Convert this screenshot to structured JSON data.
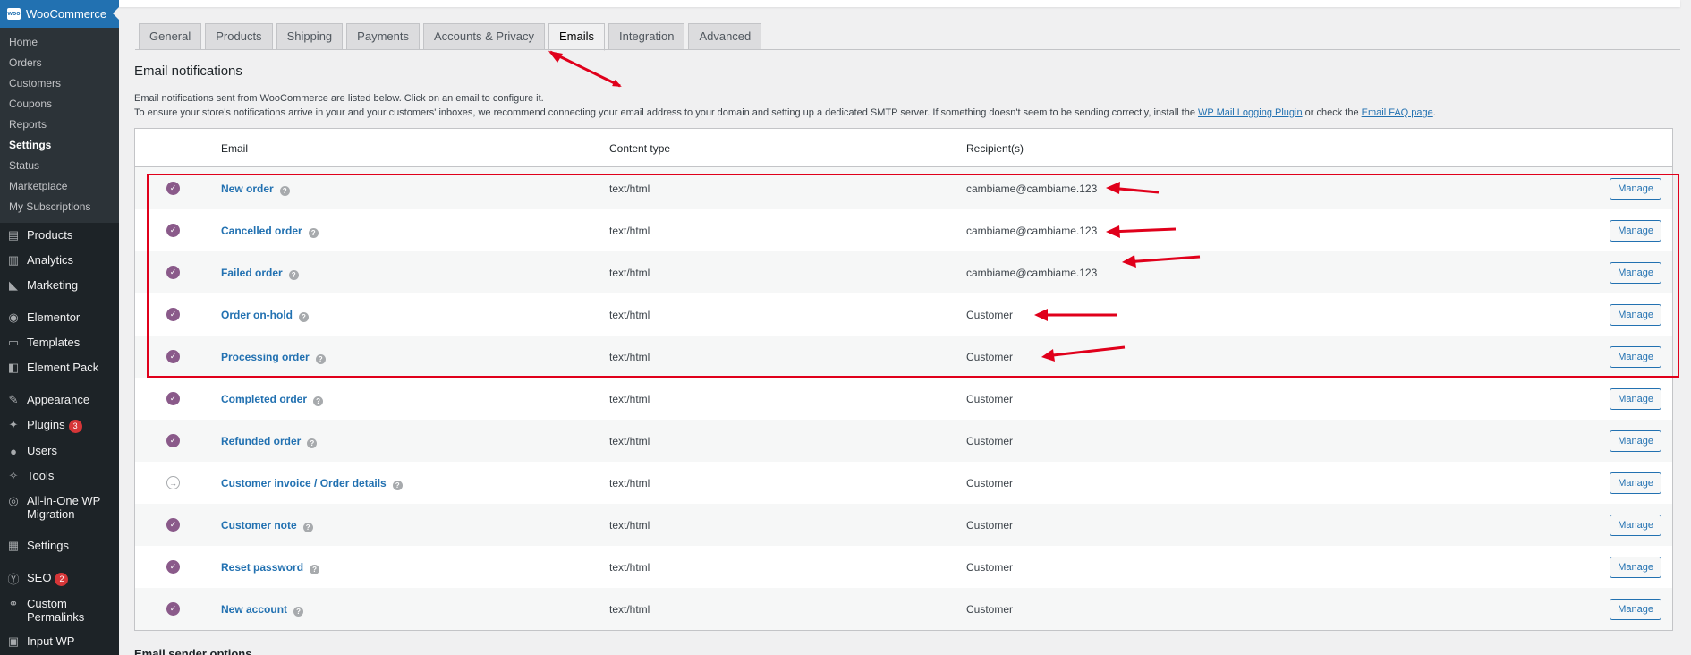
{
  "sidebar": {
    "woocommerce": {
      "logo_text": "woo",
      "label": "WooCommerce"
    },
    "submenu": [
      "Home",
      "Orders",
      "Customers",
      "Coupons",
      "Reports",
      "Settings",
      "Status",
      "Marketplace",
      "My Subscriptions"
    ],
    "active_submenu": "Settings",
    "menu": [
      {
        "label": "Products",
        "icon": "archive-icon",
        "glyph": "▤"
      },
      {
        "label": "Analytics",
        "icon": "bar-chart-icon",
        "glyph": "▥"
      },
      {
        "label": "Marketing",
        "icon": "megaphone-icon",
        "glyph": "◣"
      },
      {
        "label": "Elementor",
        "icon": "elementor-icon",
        "glyph": "◉"
      },
      {
        "label": "Templates",
        "icon": "folder-icon",
        "glyph": "▭"
      },
      {
        "label": "Element Pack",
        "icon": "element-pack-icon",
        "glyph": "◧"
      },
      {
        "label": "Appearance",
        "icon": "brush-icon",
        "glyph": "✎"
      },
      {
        "label": "Plugins",
        "icon": "plug-icon",
        "glyph": "✦",
        "badge": "3"
      },
      {
        "label": "Users",
        "icon": "user-icon",
        "glyph": "●"
      },
      {
        "label": "Tools",
        "icon": "wrench-icon",
        "glyph": "✧"
      },
      {
        "label": "All-in-One WP Migration",
        "icon": "migration-icon",
        "glyph": "◎"
      },
      {
        "label": "Settings",
        "icon": "settings-icon",
        "glyph": "▦"
      },
      {
        "label": "SEO",
        "icon": "yoast-icon",
        "glyph": "Ⓨ",
        "badge": "2"
      },
      {
        "label": "Custom Permalinks",
        "icon": "link-icon",
        "glyph": "⚭"
      },
      {
        "label": "Input WP",
        "icon": "input-icon",
        "glyph": "▣"
      }
    ]
  },
  "tabs": [
    {
      "label": "General",
      "active": false
    },
    {
      "label": "Products",
      "active": false
    },
    {
      "label": "Shipping",
      "active": false
    },
    {
      "label": "Payments",
      "active": false
    },
    {
      "label": "Accounts & Privacy",
      "active": false
    },
    {
      "label": "Emails",
      "active": true
    },
    {
      "label": "Integration",
      "active": false
    },
    {
      "label": "Advanced",
      "active": false
    }
  ],
  "section": {
    "title": "Email notifications",
    "desc_line1": "Email notifications sent from WooCommerce are listed below. Click on an email to configure it.",
    "desc_line2_pre": "To ensure your store's notifications arrive in your and your customers' inboxes, we recommend connecting your email address to your domain and setting up a dedicated SMTP server. If something doesn't seem to be sending correctly, install the ",
    "desc_link1": "WP Mail Logging Plugin",
    "desc_mid": " or check the ",
    "desc_link2": "Email FAQ page",
    "desc_end": "."
  },
  "table": {
    "headers": {
      "email": "Email",
      "content_type": "Content type",
      "recipients": "Recipient(s)"
    },
    "manage_label": "Manage",
    "help_glyph": "?",
    "rows": [
      {
        "name": "New order",
        "content_type": "text/html",
        "recipient": "cambiame@cambiame.123",
        "status": "enabled"
      },
      {
        "name": "Cancelled order",
        "content_type": "text/html",
        "recipient": "cambiame@cambiame.123",
        "status": "enabled"
      },
      {
        "name": "Failed order",
        "content_type": "text/html",
        "recipient": "cambiame@cambiame.123",
        "status": "enabled"
      },
      {
        "name": "Order on-hold",
        "content_type": "text/html",
        "recipient": "Customer",
        "status": "enabled"
      },
      {
        "name": "Processing order",
        "content_type": "text/html",
        "recipient": "Customer",
        "status": "enabled"
      },
      {
        "name": "Completed order",
        "content_type": "text/html",
        "recipient": "Customer",
        "status": "enabled"
      },
      {
        "name": "Refunded order",
        "content_type": "text/html",
        "recipient": "Customer",
        "status": "enabled"
      },
      {
        "name": "Customer invoice / Order details",
        "content_type": "text/html",
        "recipient": "Customer",
        "status": "manual"
      },
      {
        "name": "Customer note",
        "content_type": "text/html",
        "recipient": "Customer",
        "status": "enabled"
      },
      {
        "name": "Reset password",
        "content_type": "text/html",
        "recipient": "Customer",
        "status": "enabled"
      },
      {
        "name": "New account",
        "content_type": "text/html",
        "recipient": "Customer",
        "status": "enabled"
      }
    ]
  },
  "bottom": {
    "title": "Email sender options"
  },
  "colors": {
    "accent": "#2271b1",
    "sidebar": "#1d2327",
    "annotation": "#e0001b",
    "enabled": "#8a5a8a"
  }
}
